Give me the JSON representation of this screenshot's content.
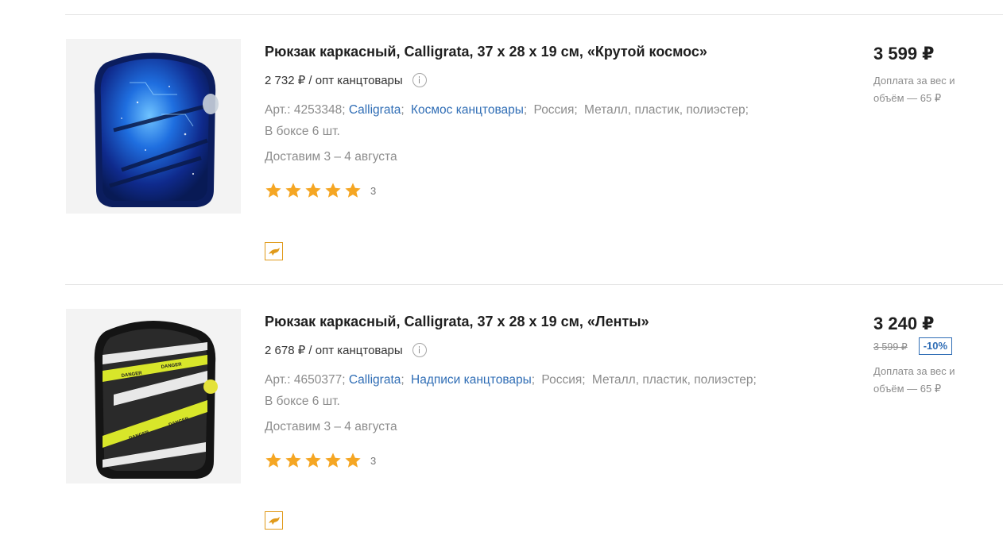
{
  "products": [
    {
      "title": "Рюкзак каркасный, Calligrata, 37 х 28 х 19 см, «Крутой космос»",
      "wholesale_price": "2 732 ₽ / опт канцтовары",
      "article": "Арт.: 4253348;",
      "brand": "Calligrata",
      "category": "Космос канцтовары",
      "country": "Россия",
      "material": "Металл, пластик, полиэстер;",
      "box": "В боксе 6 шт.",
      "delivery": "Доставим 3 – 4 августа",
      "rating": 5,
      "rating_count": "3",
      "price": "3 599 ₽",
      "surcharge": "Доплата за вес и объём — 65 ₽",
      "image_icon": "backpack-space-image"
    },
    {
      "title": "Рюкзак каркасный, Calligrata, 37 х 28 х 19 см, «Ленты»",
      "wholesale_price": "2 678 ₽ / опт канцтовары",
      "article": "Арт.: 4650377;",
      "brand": "Calligrata",
      "category": "Надписи канцтовары",
      "country": "Россия",
      "material": "Металл, пластик, полиэстер;",
      "box": "В боксе 6 шт.",
      "delivery": "Доставим 3 – 4 августа",
      "rating": 5,
      "rating_count": "3",
      "price": "3 240 ₽",
      "old_price": "3 599 ₽",
      "discount": "-10%",
      "surcharge": "Доплата за вес и объём — 65 ₽",
      "image_icon": "backpack-tape-image"
    }
  ],
  "colors": {
    "link": "#2f6db5",
    "star": "#f5a623",
    "badge_border": "#e09a1a"
  }
}
